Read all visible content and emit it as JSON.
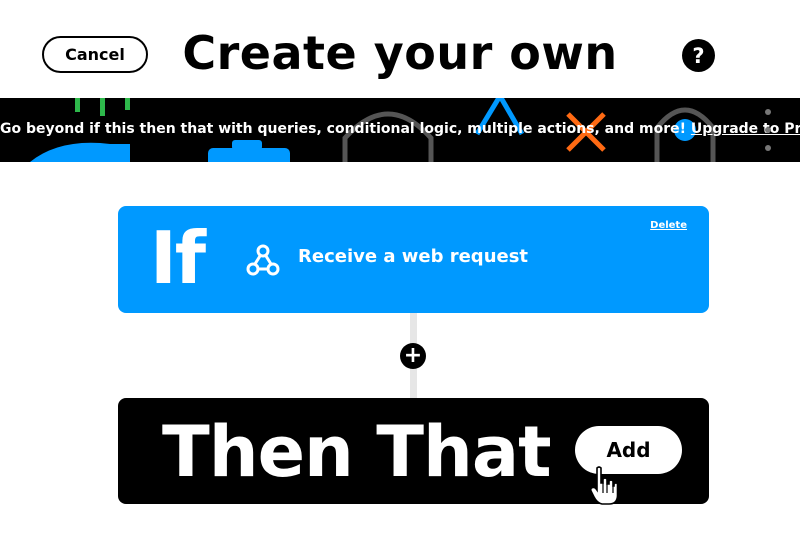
{
  "header": {
    "cancel_label": "Cancel",
    "title": "Create your own",
    "help_label": "?"
  },
  "banner": {
    "text": "Go beyond if this then that with queries, conditional logic, multiple actions, and more!",
    "link_label": "Upgrade to Pro"
  },
  "if_card": {
    "label": "If",
    "trigger": "Receive a web request",
    "delete_label": "Delete",
    "color": "#0099ff"
  },
  "add_step": {
    "label": "+"
  },
  "then_card": {
    "label": "Then That",
    "add_label": "Add",
    "color": "#000000"
  }
}
